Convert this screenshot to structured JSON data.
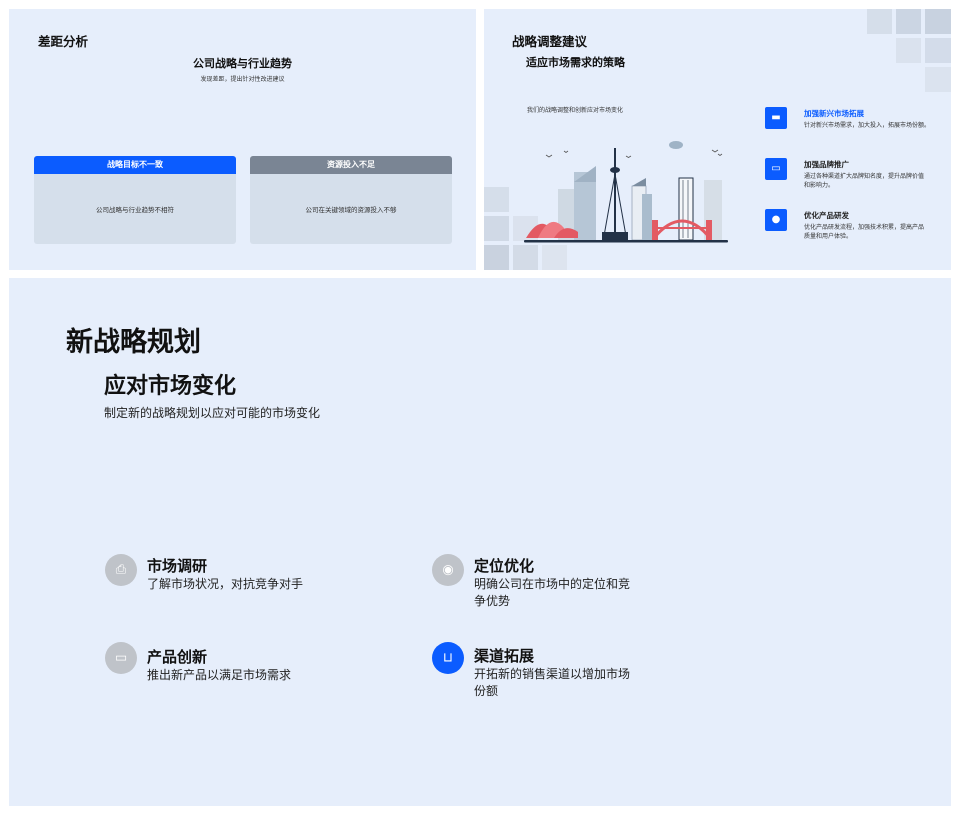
{
  "slide1": {
    "title": "差距分析",
    "subtitle": "公司战略与行业趋势",
    "caption": "发现差距，提出针对性改进建议",
    "cards": [
      {
        "header": "战略目标不一致",
        "body": "公司战略与行业趋势不相符",
        "color": "#0b5cff"
      },
      {
        "header": "资源投入不足",
        "body": "公司在关键领域的资源投入不够",
        "color": "#7a8594"
      }
    ]
  },
  "slide2": {
    "title": "战略调整建议",
    "subtitle": "适应市场需求的策略",
    "intro": "我们的战略调整和创新应对市场变化",
    "items": [
      {
        "title": "加强新兴市场拓展",
        "desc": "针对新兴市场需求，加大投入，拓展市场份额。",
        "icon": "briefcase-icon",
        "highlight": true
      },
      {
        "title": "加强品牌推广",
        "desc": "通过各种渠道扩大品牌知名度，提升品牌价值和影响力。",
        "icon": "inbox-icon",
        "highlight": false
      },
      {
        "title": "优化产品研发",
        "desc": "优化产品研发流程，加强技术积累，提高产品质量和用户体验。",
        "icon": "location-pin-icon",
        "highlight": false
      }
    ]
  },
  "slide3": {
    "title": "新战略规划",
    "subtitle": "应对市场变化",
    "caption": "制定新的战略规划以应对可能的市场变化",
    "features": [
      {
        "title": "市场调研",
        "desc": "了解市场状况，对抗竞争对手",
        "icon": "printer-icon",
        "active": false
      },
      {
        "title": "定位优化",
        "desc": "明确公司在市场中的定位和竞争优势",
        "icon": "webcam-icon",
        "active": false
      },
      {
        "title": "产品创新",
        "desc": "推出新产品以满足市场需求",
        "icon": "briefcase-icon",
        "active": false
      },
      {
        "title": "渠道拓展",
        "desc": "开拓新的销售渠道以增加市场份额",
        "icon": "sofa-icon",
        "active": true
      }
    ]
  },
  "colors": {
    "accent": "#0b5cff",
    "slide_bg": "#e6eefb",
    "muted_icon": "#bfc3c9",
    "gray_header": "#7a8594"
  }
}
